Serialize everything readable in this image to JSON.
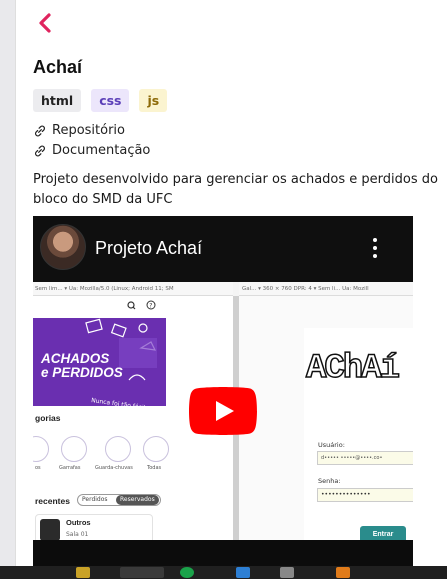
{
  "project": {
    "title": "Achaí",
    "tags": [
      "html",
      "css",
      "js"
    ],
    "links": [
      {
        "label": "Repositório",
        "icon": "link-icon"
      },
      {
        "label": "Documentação",
        "icon": "link-icon"
      }
    ],
    "description_line1": "Projeto desenvolvido para gerenciar os achados e perdidos do",
    "description_line2": "bloco do SMD da UFC"
  },
  "video": {
    "title": "Projeto Achaí",
    "left_devtools_text": "Sem lim... ▾  Ua: Mozilla/5.0 (Linux; Android 11; SM",
    "right_devtools_text": "Gal... ▾  360  ×  760   DPR: 4  ▾  Sem li...  Ua: Mozill",
    "app": {
      "hero_line1": "ACHADOS",
      "hero_line2": "e PERDIDOS",
      "categories_heading": "gorias",
      "category_labels": [
        "os",
        "Garrafas",
        "Guarda-chuvas",
        "Todas"
      ],
      "recents_heading": "recentes",
      "segment_options": [
        "Perdidos",
        "Reservados"
      ],
      "item_title": "Outros",
      "item_room": "Sala 01"
    },
    "login": {
      "logo_text": "AChAí",
      "user_label": "Usuário:",
      "user_value": "d••••• •••••@••••.co•",
      "password_label": "Senha:",
      "password_value": "••••••••••••••",
      "submit_label": "Entrar"
    }
  },
  "colors": {
    "back_arrow": "#e0245e",
    "youtube_red": "#ff0000",
    "app_purple": "#6a2fb0",
    "login_teal": "#2a8c8c"
  }
}
